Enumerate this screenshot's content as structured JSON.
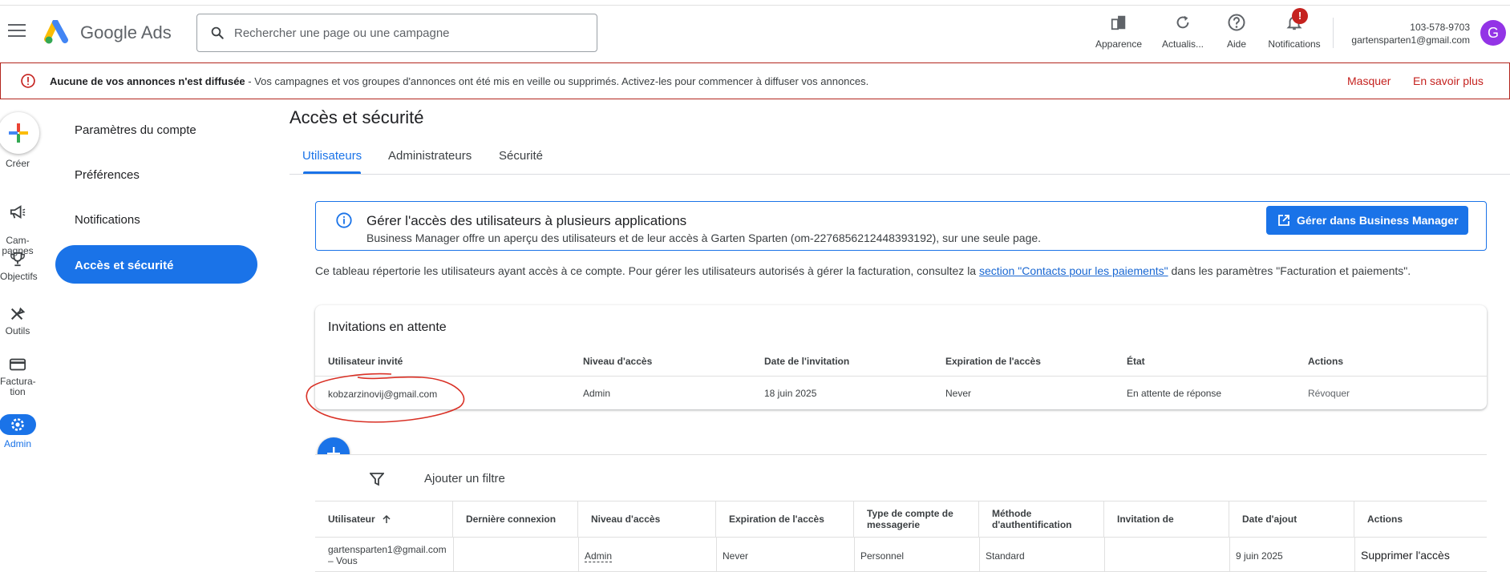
{
  "header": {
    "product_name": "Google Ads",
    "search_placeholder": "Rechercher une page ou une campagne",
    "icons": [
      {
        "label": "Apparence",
        "icon": "appearance-icon"
      },
      {
        "label": "Actualis...",
        "icon": "refresh-icon"
      },
      {
        "label": "Aide",
        "icon": "help-icon"
      },
      {
        "label": "Notifications",
        "icon": "bell-icon",
        "badge": "!"
      }
    ],
    "account_id": "103-578-9703",
    "account_email": "gartensparten1@gmail.com",
    "avatar_letter": "G"
  },
  "alert": {
    "title": "Aucune de vos annonces n'est diffusée",
    "text": " - Vos campagnes et vos groupes d'annonces ont été mis en veille ou supprimés. Activez-les pour commencer à diffuser vos annonces.",
    "dismiss": "Masquer",
    "learn_more": "En savoir plus"
  },
  "rail": {
    "create": "Créer",
    "campaigns": "Cam-\npagnes",
    "goals": "Objectifs",
    "tools": "Outils",
    "billing": "Factura-\ntion",
    "admin": "Admin"
  },
  "subnav": {
    "items": [
      "Paramètres du compte",
      "Préférences",
      "Notifications"
    ],
    "active": "Accès et sécurité"
  },
  "main": {
    "title": "Accès et sécurité",
    "tabs": [
      "Utilisateurs",
      "Administrateurs",
      "Sécurité"
    ],
    "info_title": "Gérer l'accès des utilisateurs à plusieurs applications",
    "info_text": "Business Manager offre un aperçu des utilisateurs et de leur accès à Garten Sparten (om-2276856212448393192), sur une seule page.",
    "info_button": "Gérer dans Business Manager",
    "desc_before": "Ce tableau répertorie les utilisateurs ayant accès à ce compte. Pour gérer les utilisateurs autorisés à gérer la facturation, consultez la ",
    "desc_link": "section \"Contacts pour les paiements\"",
    "desc_after": " dans les paramètres \"Facturation et paiements\"."
  },
  "pending": {
    "title": "Invitations en attente",
    "headers": [
      "Utilisateur invité",
      "Niveau d'accès",
      "Date de l'invitation",
      "Expiration de l'accès",
      "État",
      "Actions"
    ],
    "row": {
      "user": "kobzarzinovij@gmail.com",
      "level": "Admin",
      "date": "18 juin 2025",
      "expiration": "Never",
      "state": "En attente de réponse",
      "action": "Révoquer"
    }
  },
  "users": {
    "filter_label": "Ajouter un filtre",
    "headers": [
      "Utilisateur",
      "Dernière connexion",
      "Niveau d'accès",
      "Expiration de l'accès",
      "Type de compte de messagerie",
      "Méthode d'authentification",
      "Invitation de",
      "Date d'ajout",
      "Actions"
    ],
    "row": {
      "user": "gartensparten1@gmail.com – Vous",
      "last_login": "",
      "level": "Admin",
      "expiration": "Never",
      "account_type": "Personnel",
      "auth": "Standard",
      "invited_by": "",
      "date_added": "9 juin 2025",
      "action": "Supprimer l'accès"
    }
  },
  "colors": {
    "accent": "#1a73e8",
    "alert_red": "#c5221f",
    "annotation_red": "#d93025"
  }
}
